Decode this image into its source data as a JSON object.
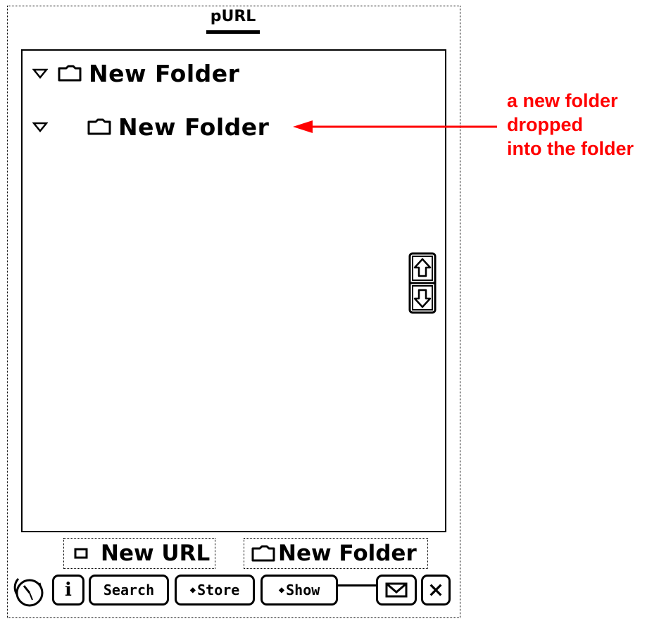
{
  "window": {
    "title": "pURL"
  },
  "tree": {
    "items": [
      {
        "label": "New Folder",
        "expanded": true,
        "depth": 0,
        "icon": "folder-icon"
      },
      {
        "label": "New Folder",
        "expanded": true,
        "depth": 1,
        "icon": "folder-icon"
      }
    ]
  },
  "buttons": {
    "new_url": "New URL",
    "new_folder": "New Folder"
  },
  "toolbar": {
    "info": "i",
    "search": "Search",
    "store": "Store",
    "show": "Show"
  },
  "annotation": {
    "lines": [
      "a new folder",
      "dropped",
      "into the folder"
    ],
    "color": "#ff0000"
  }
}
